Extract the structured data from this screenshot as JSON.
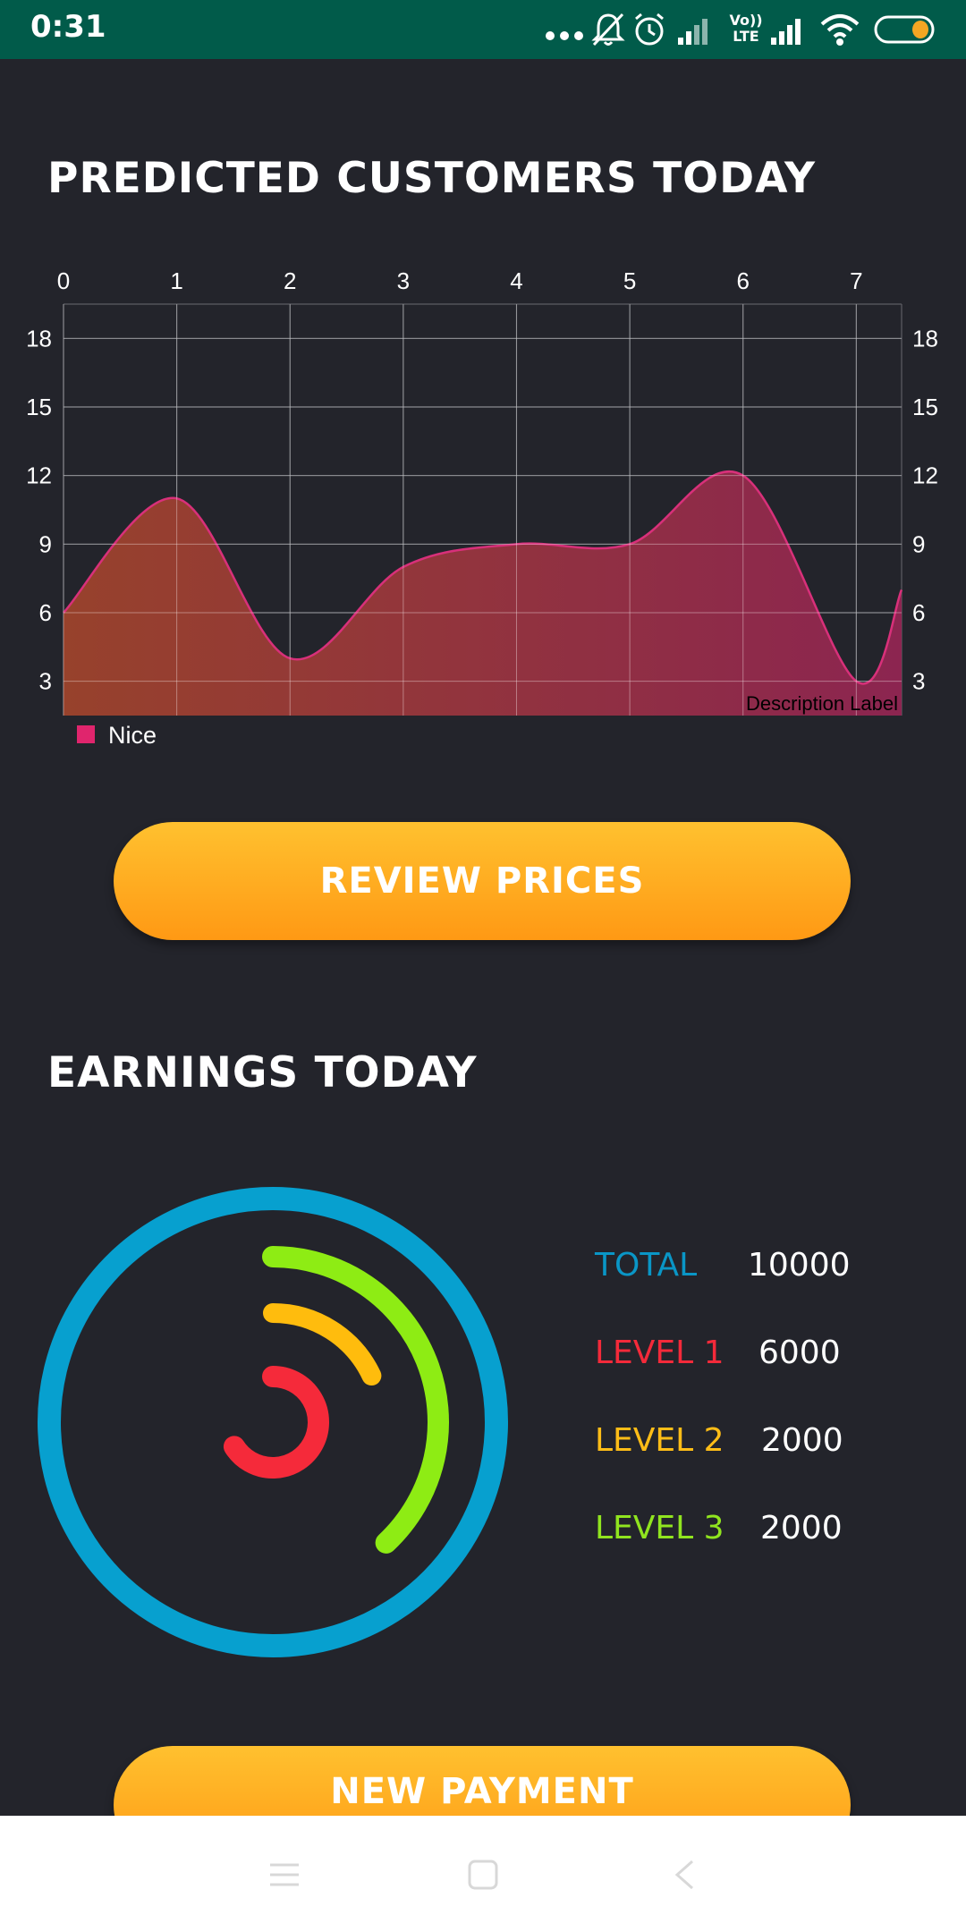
{
  "status_bar": {
    "time": "0:31",
    "icons": [
      "more-dots-icon",
      "bell-off-icon",
      "alarm-icon",
      "signal-icon",
      "volte-icon",
      "signal-icon",
      "wifi-icon",
      "battery-icon"
    ],
    "volte_text_top": "Vo))",
    "volte_text_bottom": "LTE",
    "accent": "#015b4a"
  },
  "customers_section": {
    "title": "PREDICTED CUSTOMERS TODAY",
    "review_button_label": "REVIEW PRICES"
  },
  "chart_data": {
    "type": "area",
    "x": [
      0,
      1,
      2,
      3,
      4,
      5,
      6,
      7,
      7.4
    ],
    "x_ticks": [
      "0",
      "1",
      "2",
      "3",
      "4",
      "5",
      "6",
      "7"
    ],
    "y_ticks": [
      "3",
      "6",
      "9",
      "12",
      "15",
      "18"
    ],
    "series": [
      {
        "name": "Nice",
        "values": [
          6,
          11,
          4,
          8,
          9,
          9,
          12,
          3,
          7
        ]
      }
    ],
    "xlim": [
      0,
      7.4
    ],
    "ylim": [
      1.5,
      19.5
    ],
    "grid": true,
    "legend_position": "bottom-left",
    "description_label": "Description Label",
    "colors": {
      "fill_start": "#a0442c",
      "fill_end": "#942553",
      "line": "#d8307a",
      "legend": "#e0256d"
    }
  },
  "earnings_section": {
    "title": "EARNINGS TODAY",
    "stats": [
      {
        "label": "TOTAL",
        "value": "10000",
        "color": "#0a96c6"
      },
      {
        "label": "LEVEL 1",
        "value": "6000",
        "color": "#f42a3a"
      },
      {
        "label": "LEVEL 2",
        "value": "2000",
        "color": "#ffbd17"
      },
      {
        "label": "LEVEL 3",
        "value": "2000",
        "color": "#90e41f"
      }
    ],
    "new_payment_label": "NEW PAYMENT"
  },
  "ring_chart": {
    "rings": [
      {
        "name": "total",
        "fraction": 1.0,
        "color": "#07a0cf"
      },
      {
        "name": "level-3",
        "fraction": 0.38,
        "color": "#8eec14"
      },
      {
        "name": "level-2",
        "fraction": 0.18,
        "color": "#ffbc0d"
      },
      {
        "name": "level-1",
        "fraction": 0.66,
        "color": "#f52a3a"
      }
    ]
  },
  "nav_bar": {
    "icons": [
      "menu-icon",
      "home-square-icon",
      "back-chevron-icon"
    ]
  }
}
